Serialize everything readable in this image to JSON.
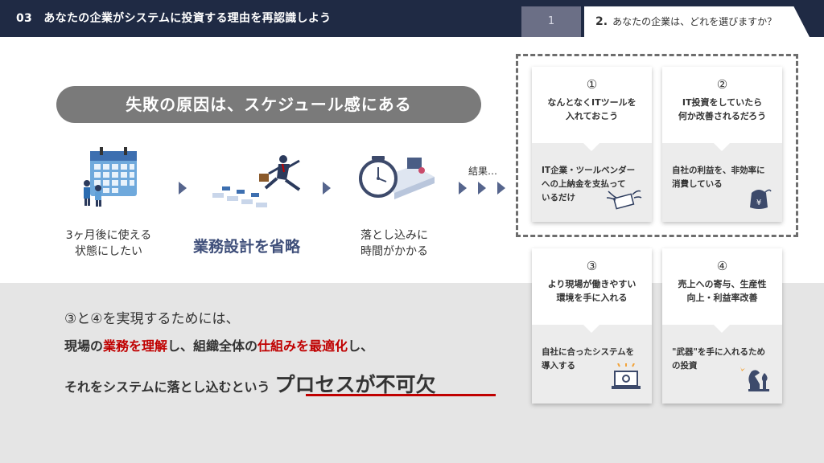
{
  "header": {
    "title": "03　あなたの企業がシステムに投資する理由を再認識しよう",
    "tab1": "1",
    "tab2_num": "2.",
    "tab2_label": "あなたの企業は、どれを選びますか？"
  },
  "pill": "失敗の原因は、スケジュール感にある",
  "steps": {
    "s1_line1": "3ヶ月後に使える",
    "s1_line2": "状態にしたい",
    "s2": "業務設計を省略",
    "s3_line1": "落とし込みに",
    "s3_line2": "時間がかかる",
    "result": "結果…"
  },
  "cards": [
    {
      "num": "①",
      "title1": "なんとなくITツールを",
      "title2": "入れておこう",
      "desc1": "IT企業・ツールベンダー",
      "desc2": "への上納金を支払って",
      "desc3": "いるだけ",
      "icon": "flying-money-icon"
    },
    {
      "num": "②",
      "title1": "IT投資をしていたら",
      "title2": "何か改善されるだろう",
      "desc1": "自社の利益を、非効率に",
      "desc2": "消費している",
      "desc3": "",
      "icon": "yen-wallet-icon"
    },
    {
      "num": "③",
      "title1": "より現場が働きやすい",
      "title2": "環境を手に入れる",
      "desc1": "自社に合ったシステムを",
      "desc2": "導入する",
      "desc3": "",
      "icon": "laptop-gear-icon"
    },
    {
      "num": "④",
      "title1": "売上への寄与、生産性",
      "title2": "向上・利益率改善",
      "desc1": "\"武器\"を手に入れるため",
      "desc2": "の投資",
      "desc3": "",
      "icon": "chess-pieces-icon"
    }
  ],
  "bottom": {
    "line1": "③と④を実現するためには、",
    "line2_a": "現場の",
    "line2_b": "業務を理解",
    "line2_c": "し、組織全体の",
    "line2_d": "仕組みを最適化",
    "line2_e": "し、",
    "line3_a": "それをシステムに落とし込むという",
    "line3_b": "プロセスが不可欠"
  },
  "colors": {
    "navy": "#1f2a44",
    "accent_red": "#c00000",
    "blue_text": "#3f4f7a"
  }
}
